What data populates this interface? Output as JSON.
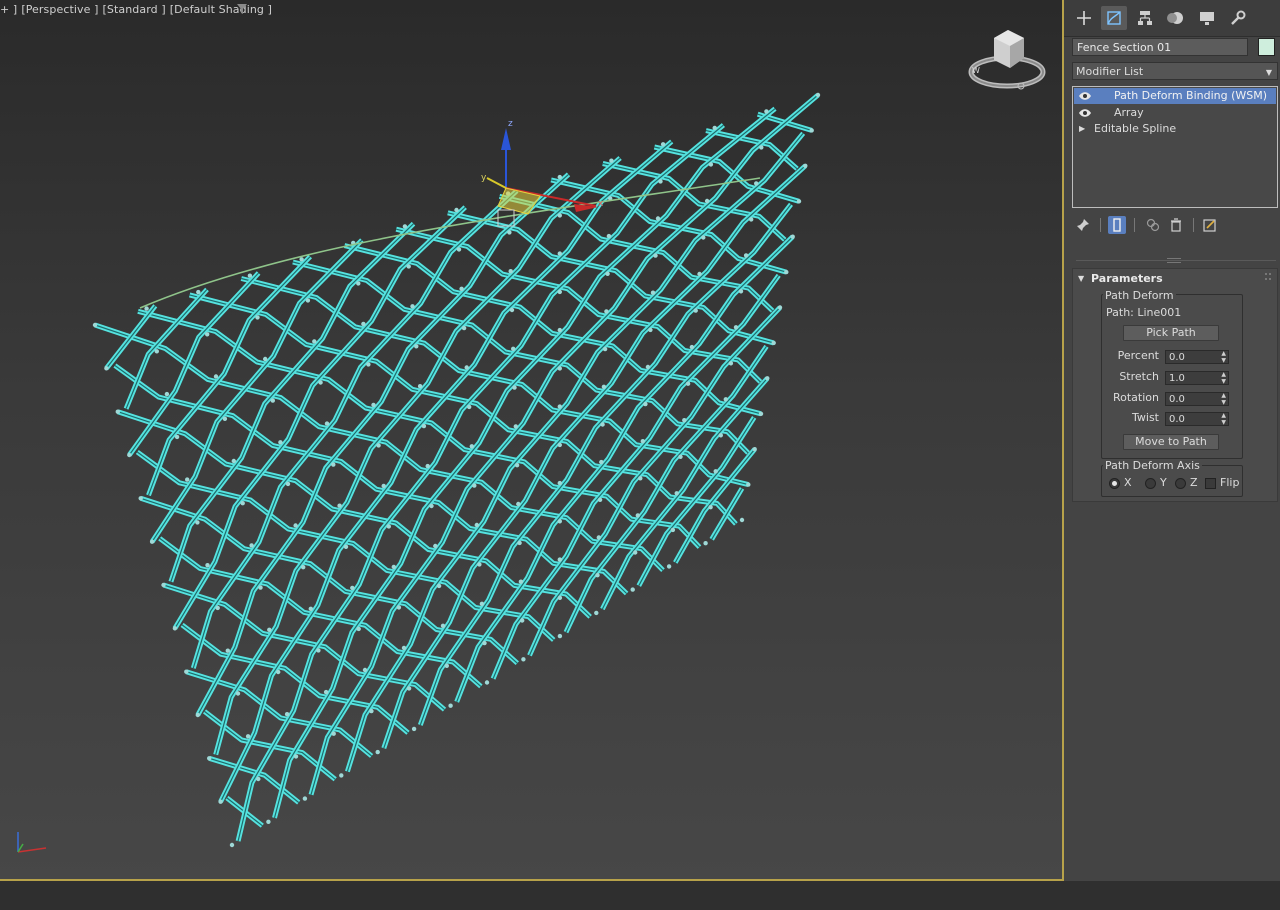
{
  "viewport": {
    "label_segments": [
      "+ ]",
      "[Perspective ]",
      "[Standard ]",
      "[Default Shading ]"
    ],
    "filter_icon": "funnel-icon",
    "gizmo_axis_labels": {
      "x": "x",
      "y": "y",
      "z": "z"
    },
    "colors": {
      "mesh": "#55e3e0",
      "path_spline": "#8fc48a",
      "frame": "#b7a24a"
    }
  },
  "command_panel": {
    "tabs": [
      {
        "name": "create",
        "icon": "plus-icon"
      },
      {
        "name": "modify",
        "icon": "modify-icon",
        "active": true
      },
      {
        "name": "hierarchy",
        "icon": "hierarchy-icon"
      },
      {
        "name": "motion",
        "icon": "motion-icon"
      },
      {
        "name": "display",
        "icon": "display-icon"
      },
      {
        "name": "utilities",
        "icon": "wrench-icon"
      }
    ],
    "object_name": "Fence Section 01",
    "object_color": "#cfeedd",
    "modifier_list": "Modifier List",
    "stack": [
      {
        "label": "Path Deform Binding (WSM)",
        "selected": true
      },
      {
        "label": "Array",
        "selected": false
      },
      {
        "label": "Editable Spline",
        "selected": false
      }
    ],
    "rollout": {
      "title": "Parameters",
      "group_path_deform": "Path Deform",
      "path_label": "Path: Line001",
      "pick_path": "Pick Path",
      "fields": [
        {
          "label": "Percent",
          "value": "0.0"
        },
        {
          "label": "Stretch",
          "value": "1.0"
        },
        {
          "label": "Rotation",
          "value": "0.0"
        },
        {
          "label": "Twist",
          "value": "0.0"
        }
      ],
      "move_to_path": "Move to Path",
      "group_axis": "Path Deform Axis",
      "axes": [
        {
          "label": "X",
          "selected": true
        },
        {
          "label": "Y",
          "selected": false
        },
        {
          "label": "Z",
          "selected": false
        }
      ],
      "flip": "Flip"
    }
  }
}
